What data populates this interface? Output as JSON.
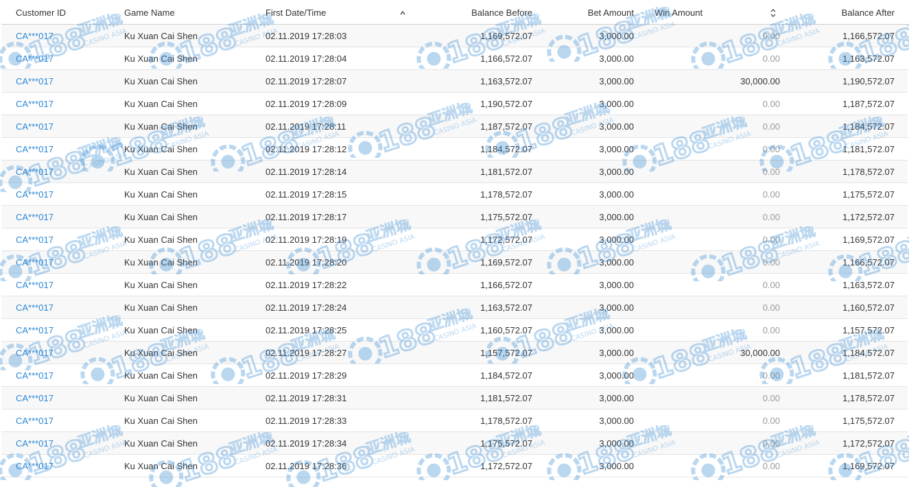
{
  "columns": {
    "customer_id": "Customer ID",
    "game_name": "Game Name",
    "first_datetime": "First Date/Time",
    "balance_before": "Balance Before",
    "bet_amount": "Bet Amount",
    "win_amount": "Win Amount",
    "balance_after": "Balance After"
  },
  "sort_icons": {
    "date": "sort-ascending-icon",
    "win": "sort-both-icon"
  },
  "watermark": {
    "logo_text": "C188",
    "cn_text": "亚洲城",
    "en_text": "CASINO ASIA",
    "color": "#3d8fd6"
  },
  "colors": {
    "link": "#2a86d6",
    "zero": "#9a9a9a",
    "alt_row": "#f8f8f8"
  },
  "rows": [
    {
      "id": "CA***017",
      "game": "Ku Xuan Cai Shen",
      "date": "02.11.2019 17:28:03",
      "bb": "1,169,572.07",
      "bet": "3,000.00",
      "win": "0.00",
      "ba": "1,166,572.07"
    },
    {
      "id": "CA***017",
      "game": "Ku Xuan Cai Shen",
      "date": "02.11.2019 17:28:04",
      "bb": "1,166,572.07",
      "bet": "3,000.00",
      "win": "0.00",
      "ba": "1,163,572.07"
    },
    {
      "id": "CA***017",
      "game": "Ku Xuan Cai Shen",
      "date": "02.11.2019 17:28:07",
      "bb": "1,163,572.07",
      "bet": "3,000.00",
      "win": "30,000.00",
      "ba": "1,190,572.07"
    },
    {
      "id": "CA***017",
      "game": "Ku Xuan Cai Shen",
      "date": "02.11.2019 17:28:09",
      "bb": "1,190,572.07",
      "bet": "3,000.00",
      "win": "0.00",
      "ba": "1,187,572.07"
    },
    {
      "id": "CA***017",
      "game": "Ku Xuan Cai Shen",
      "date": "02.11.2019 17:28:11",
      "bb": "1,187,572.07",
      "bet": "3,000.00",
      "win": "0.00",
      "ba": "1,184,572.07"
    },
    {
      "id": "CA***017",
      "game": "Ku Xuan Cai Shen",
      "date": "02.11.2019 17:28:12",
      "bb": "1,184,572.07",
      "bet": "3,000.00",
      "win": "0.00",
      "ba": "1,181,572.07"
    },
    {
      "id": "CA***017",
      "game": "Ku Xuan Cai Shen",
      "date": "02.11.2019 17:28:14",
      "bb": "1,181,572.07",
      "bet": "3,000.00",
      "win": "0.00",
      "ba": "1,178,572.07"
    },
    {
      "id": "CA***017",
      "game": "Ku Xuan Cai Shen",
      "date": "02.11.2019 17:28:15",
      "bb": "1,178,572.07",
      "bet": "3,000.00",
      "win": "0.00",
      "ba": "1,175,572.07"
    },
    {
      "id": "CA***017",
      "game": "Ku Xuan Cai Shen",
      "date": "02.11.2019 17:28:17",
      "bb": "1,175,572.07",
      "bet": "3,000.00",
      "win": "0.00",
      "ba": "1,172,572.07"
    },
    {
      "id": "CA***017",
      "game": "Ku Xuan Cai Shen",
      "date": "02.11.2019 17:28:19",
      "bb": "1,172,572.07",
      "bet": "3,000.00",
      "win": "0.00",
      "ba": "1,169,572.07"
    },
    {
      "id": "CA***017",
      "game": "Ku Xuan Cai Shen",
      "date": "02.11.2019 17:28:20",
      "bb": "1,169,572.07",
      "bet": "3,000.00",
      "win": "0.00",
      "ba": "1,166,572.07"
    },
    {
      "id": "CA***017",
      "game": "Ku Xuan Cai Shen",
      "date": "02.11.2019 17:28:22",
      "bb": "1,166,572.07",
      "bet": "3,000.00",
      "win": "0.00",
      "ba": "1,163,572.07"
    },
    {
      "id": "CA***017",
      "game": "Ku Xuan Cai Shen",
      "date": "02.11.2019 17:28:24",
      "bb": "1,163,572.07",
      "bet": "3,000.00",
      "win": "0.00",
      "ba": "1,160,572.07"
    },
    {
      "id": "CA***017",
      "game": "Ku Xuan Cai Shen",
      "date": "02.11.2019 17:28:25",
      "bb": "1,160,572.07",
      "bet": "3,000.00",
      "win": "0.00",
      "ba": "1,157,572.07"
    },
    {
      "id": "CA***017",
      "game": "Ku Xuan Cai Shen",
      "date": "02.11.2019 17:28:27",
      "bb": "1,157,572.07",
      "bet": "3,000.00",
      "win": "30,000.00",
      "ba": "1,184,572.07"
    },
    {
      "id": "CA***017",
      "game": "Ku Xuan Cai Shen",
      "date": "02.11.2019 17:28:29",
      "bb": "1,184,572.07",
      "bet": "3,000.00",
      "win": "0.00",
      "ba": "1,181,572.07"
    },
    {
      "id": "CA***017",
      "game": "Ku Xuan Cai Shen",
      "date": "02.11.2019 17:28:31",
      "bb": "1,181,572.07",
      "bet": "3,000.00",
      "win": "0.00",
      "ba": "1,178,572.07"
    },
    {
      "id": "CA***017",
      "game": "Ku Xuan Cai Shen",
      "date": "02.11.2019 17:28:33",
      "bb": "1,178,572.07",
      "bet": "3,000.00",
      "win": "0.00",
      "ba": "1,175,572.07"
    },
    {
      "id": "CA***017",
      "game": "Ku Xuan Cai Shen",
      "date": "02.11.2019 17:28:34",
      "bb": "1,175,572.07",
      "bet": "3,000.00",
      "win": "0.00",
      "ba": "1,172,572.07"
    },
    {
      "id": "CA***017",
      "game": "Ku Xuan Cai Shen",
      "date": "02.11.2019 17:28:36",
      "bb": "1,172,572.07",
      "bet": "3,000.00",
      "win": "0.00",
      "ba": "1,169,572.07"
    }
  ]
}
